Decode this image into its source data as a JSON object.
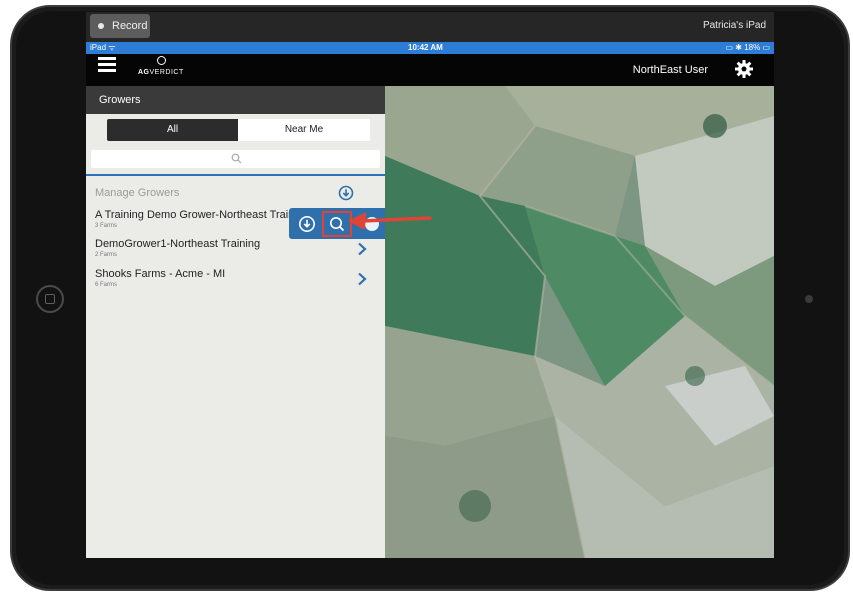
{
  "recorder": {
    "record_label": "Record",
    "device_name": "Patricia's iPad"
  },
  "status_bar": {
    "carrier": "iPad",
    "time": "10:42 AM",
    "battery": "18%"
  },
  "app_bar": {
    "logo_text_bold": "AG",
    "logo_text": "VERDICT",
    "user_name": "NorthEast User"
  },
  "sidebar": {
    "title": "Growers",
    "tabs": [
      {
        "label": "All",
        "selected": true
      },
      {
        "label": "Near Me",
        "selected": false
      }
    ],
    "search": {
      "placeholder": ""
    },
    "manage_label": "Manage Growers",
    "growers": [
      {
        "name": "A Training Demo Grower-Northeast Training",
        "farms": "3 Farms"
      },
      {
        "name": "DemoGrower1-Northeast Training",
        "farms": "2 Farms"
      },
      {
        "name": "Shooks Farms - Acme - MI",
        "farms": "6 Farms"
      }
    ]
  },
  "colors": {
    "accent_blue": "#2f6fab",
    "status_blue": "#2d7dd6",
    "highlight_red": "#e04434"
  },
  "icons": {
    "menu": "hamburger-icon",
    "settings": "gear-icon",
    "search": "search-icon",
    "download": "download-icon",
    "zoom": "zoom-to-icon",
    "chevron": "chevron-right-icon"
  }
}
